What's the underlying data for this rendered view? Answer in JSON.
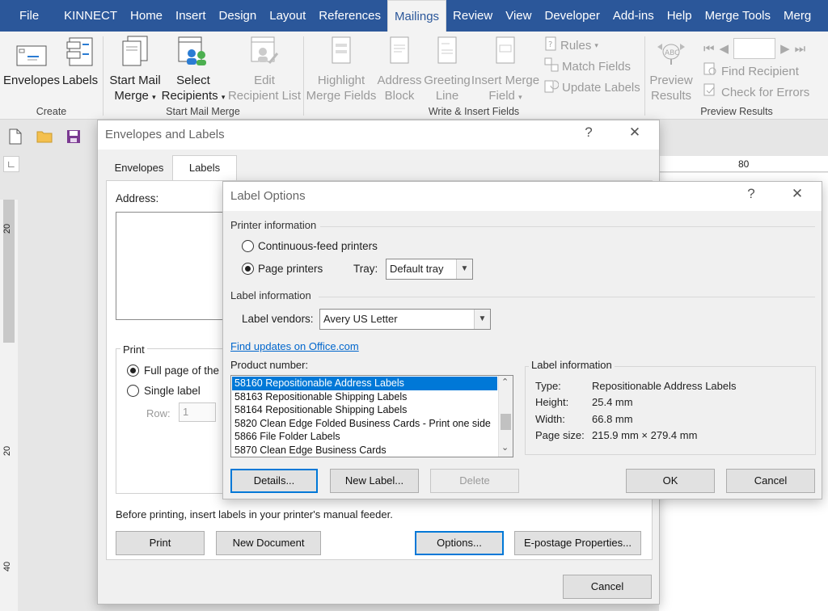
{
  "ribbon_tabs": [
    "File",
    "KINNECT",
    "Home",
    "Insert",
    "Design",
    "Layout",
    "References",
    "Mailings",
    "Review",
    "View",
    "Developer",
    "Add-ins",
    "Help",
    "Merge Tools",
    "Merg"
  ],
  "active_tab": "Mailings",
  "ribbon": {
    "create": {
      "envelopes": "Envelopes",
      "labels": "Labels",
      "group": "Create"
    },
    "start": {
      "start_l1": "Start Mail",
      "start_l2": "Merge",
      "select_l1": "Select",
      "select_l2": "Recipients",
      "edit_l1": "Edit",
      "edit_l2": "Recipient List",
      "group": "Start Mail Merge"
    },
    "write": {
      "highlight_l1": "Highlight",
      "highlight_l2": "Merge Fields",
      "address_l1": "Address",
      "address_l2": "Block",
      "greeting_l1": "Greeting",
      "greeting_l2": "Line",
      "insert_l1": "Insert Merge",
      "insert_l2": "Field",
      "rules": "Rules",
      "match": "Match Fields",
      "update": "Update Labels",
      "group": "Write & Insert Fields"
    },
    "preview": {
      "preview_l1": "Preview",
      "preview_l2": "Results",
      "find": "Find Recipient",
      "check": "Check for Errors",
      "record": "",
      "group": "Preview Results"
    }
  },
  "ruler": {
    "h_mark": "80",
    "v_marks": [
      "20",
      "20",
      "40"
    ]
  },
  "env_dialog": {
    "title": "Envelopes and Labels",
    "help": "?",
    "close": "✕",
    "tabs": [
      "Envelopes",
      "Labels"
    ],
    "address_label": "Address:",
    "print_group": "Print",
    "full_page": "Full page of the s",
    "single_label": "Single label",
    "row_label": "Row:",
    "row_value": "1",
    "note": "Before printing, insert labels in your printer's manual feeder.",
    "buttons": {
      "print": "Print",
      "new_document": "New Document",
      "options": "Options...",
      "epostage": "E-postage Properties...",
      "cancel": "Cancel"
    }
  },
  "label_options": {
    "title": "Label Options",
    "help": "?",
    "close": "✕",
    "printer_info": "Printer information",
    "continuous": "Continuous-feed printers",
    "page_printers": "Page printers",
    "tray_label": "Tray:",
    "tray_value": "Default tray",
    "label_info_hdr": "Label information",
    "vendors_label": "Label vendors:",
    "vendor_value": "Avery US Letter",
    "find_updates": "Find updates on Office.com",
    "product_label": "Product number:",
    "products": [
      "58160 Repositionable Address Labels",
      "58163 Repositionable Shipping Labels",
      "58164 Repositionable Shipping Labels",
      "5820 Clean Edge Folded Business Cards - Print one side",
      "5866 File Folder Labels",
      "5870 Clean Edge Business Cards"
    ],
    "selected_index": 0,
    "info_box": {
      "title": "Label information",
      "type_k": "Type:",
      "type_v": "Repositionable Address Labels",
      "height_k": "Height:",
      "height_v": "25.4 mm",
      "width_k": "Width:",
      "width_v": "66.8 mm",
      "page_k": "Page size:",
      "page_v": "215.9 mm × 279.4 mm"
    },
    "buttons": {
      "details": "Details...",
      "new_label": "New Label...",
      "delete": "Delete",
      "ok": "OK",
      "cancel": "Cancel"
    }
  },
  "colors": {
    "ribbon_blue": "#2b579a",
    "selection": "#0078d7",
    "link": "#0066cc"
  }
}
